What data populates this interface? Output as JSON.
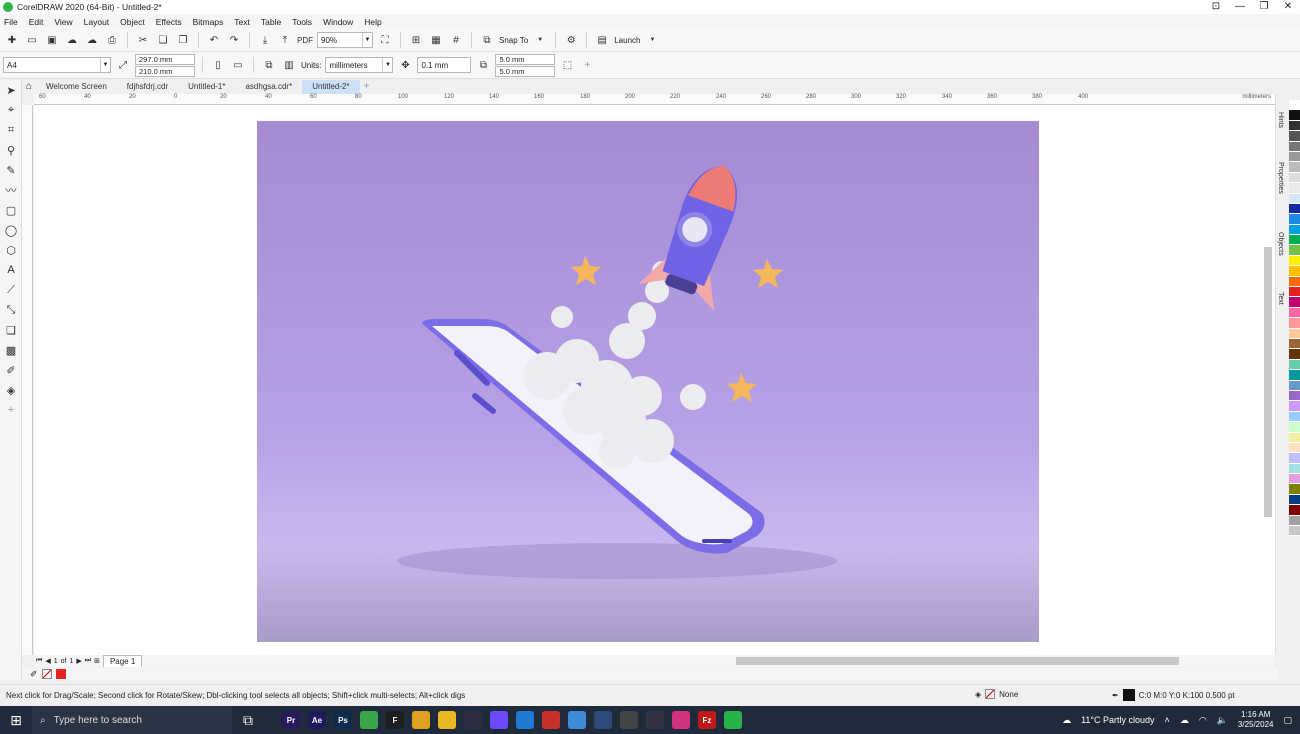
{
  "window": {
    "title": "CorelDRAW 2020 (64-Bit) - Untitled-2*"
  },
  "menu": [
    "File",
    "Edit",
    "View",
    "Layout",
    "Object",
    "Effects",
    "Bitmaps",
    "Text",
    "Table",
    "Tools",
    "Window",
    "Help"
  ],
  "toolbar": {
    "zoom": "90%",
    "snap_to": "Snap To",
    "launch": "Launch",
    "pdf": "PDF"
  },
  "property_bar": {
    "page_size": "A4",
    "width": "297.0 mm",
    "height": "210.0 mm",
    "units_label": "Units:",
    "units": "millimeters",
    "nudge": "0.1 mm",
    "dup_x": "5.0 mm",
    "dup_y": "5.0 mm"
  },
  "doc_tabs": [
    {
      "label": "Welcome Screen",
      "active": false
    },
    {
      "label": "fdjhsfdrj.cdr",
      "active": false
    },
    {
      "label": "Untitled-1*",
      "active": false
    },
    {
      "label": "asdhgsa.cdr*",
      "active": false
    },
    {
      "label": "Untitled-2*",
      "active": true
    }
  ],
  "ruler": {
    "labels": [
      "60",
      "40",
      "20",
      "0",
      "20",
      "40",
      "60",
      "80",
      "100",
      "120",
      "140",
      "160",
      "180",
      "200",
      "220",
      "240",
      "260",
      "280",
      "300",
      "320",
      "340",
      "360",
      "380",
      "400"
    ],
    "unit": "millimeters"
  },
  "dockers": [
    "Hints",
    "Properties",
    "Objects",
    "Text"
  ],
  "page_nav": {
    "current": "1",
    "of": "of",
    "total": "1",
    "page_tab": "Page 1"
  },
  "status": {
    "hint": "Next click for Drag/Scale; Second click for Rotate/Skew; Dbl-clicking tool selects all objects; Shift+click multi-selects; Alt+click digs",
    "fill": "None",
    "outline": "C:0 M:0 Y:0 K:100  0.500 pt"
  },
  "taskbar": {
    "search_placeholder": "Type here to search",
    "apps": [
      {
        "name": "premiere",
        "label": "Pr",
        "color": "#2a1a5e"
      },
      {
        "name": "after-effects",
        "label": "Ae",
        "color": "#1f1a5e"
      },
      {
        "name": "photoshop",
        "label": "Ps",
        "color": "#0c2c4f"
      },
      {
        "name": "coreldraw",
        "label": "",
        "color": "#3aa54a"
      },
      {
        "name": "figma",
        "label": "F",
        "color": "#1e1e1e"
      },
      {
        "name": "chrome",
        "label": "",
        "color": "#e0a020"
      },
      {
        "name": "file-explorer",
        "label": "",
        "color": "#e8b923"
      },
      {
        "name": "app-dark",
        "label": "",
        "color": "#2d2d44"
      },
      {
        "name": "proton-vpn",
        "label": "",
        "color": "#6d4aff"
      },
      {
        "name": "vscode",
        "label": "",
        "color": "#1e7ad3"
      },
      {
        "name": "app-red",
        "label": "",
        "color": "#c8302a"
      },
      {
        "name": "notepad",
        "label": "",
        "color": "#3f8ad6"
      },
      {
        "name": "app-nav",
        "label": "",
        "color": "#2c4a7a"
      },
      {
        "name": "app-tiles",
        "label": "",
        "color": "#444"
      },
      {
        "name": "app-sync",
        "label": "",
        "color": "#334"
      },
      {
        "name": "instagram",
        "label": "",
        "color": "#d3327e"
      },
      {
        "name": "filezilla",
        "label": "Fz",
        "color": "#c01818"
      },
      {
        "name": "whatsapp",
        "label": "",
        "color": "#25b34a"
      }
    ],
    "weather": "11°C  Partly cloudy",
    "time": "1:16 AM",
    "date": "3/25/2024"
  },
  "palette": [
    "#ffffff",
    "#111111",
    "#333333",
    "#555555",
    "#777777",
    "#999999",
    "#bbbbbb",
    "#dddddd",
    "#e9e9e9",
    "#d3e7f5",
    "#1428a0",
    "#1e88e5",
    "#00a3e0",
    "#00b050",
    "#76c043",
    "#fff200",
    "#ffc000",
    "#ff6a00",
    "#e52222",
    "#c0006e",
    "#ff66aa",
    "#ff9999",
    "#ffcc99",
    "#996633",
    "#663300",
    "#66ccaa",
    "#009999",
    "#6699cc",
    "#9966cc",
    "#cc99ff",
    "#99ccff",
    "#ccffcc",
    "#f0f0a0",
    "#ffe0c0",
    "#c0c0ff",
    "#a0e0e0",
    "#e0a0e0",
    "#808000",
    "#004080",
    "#800000",
    "#a0a0a0",
    "#c8c8c8"
  ]
}
